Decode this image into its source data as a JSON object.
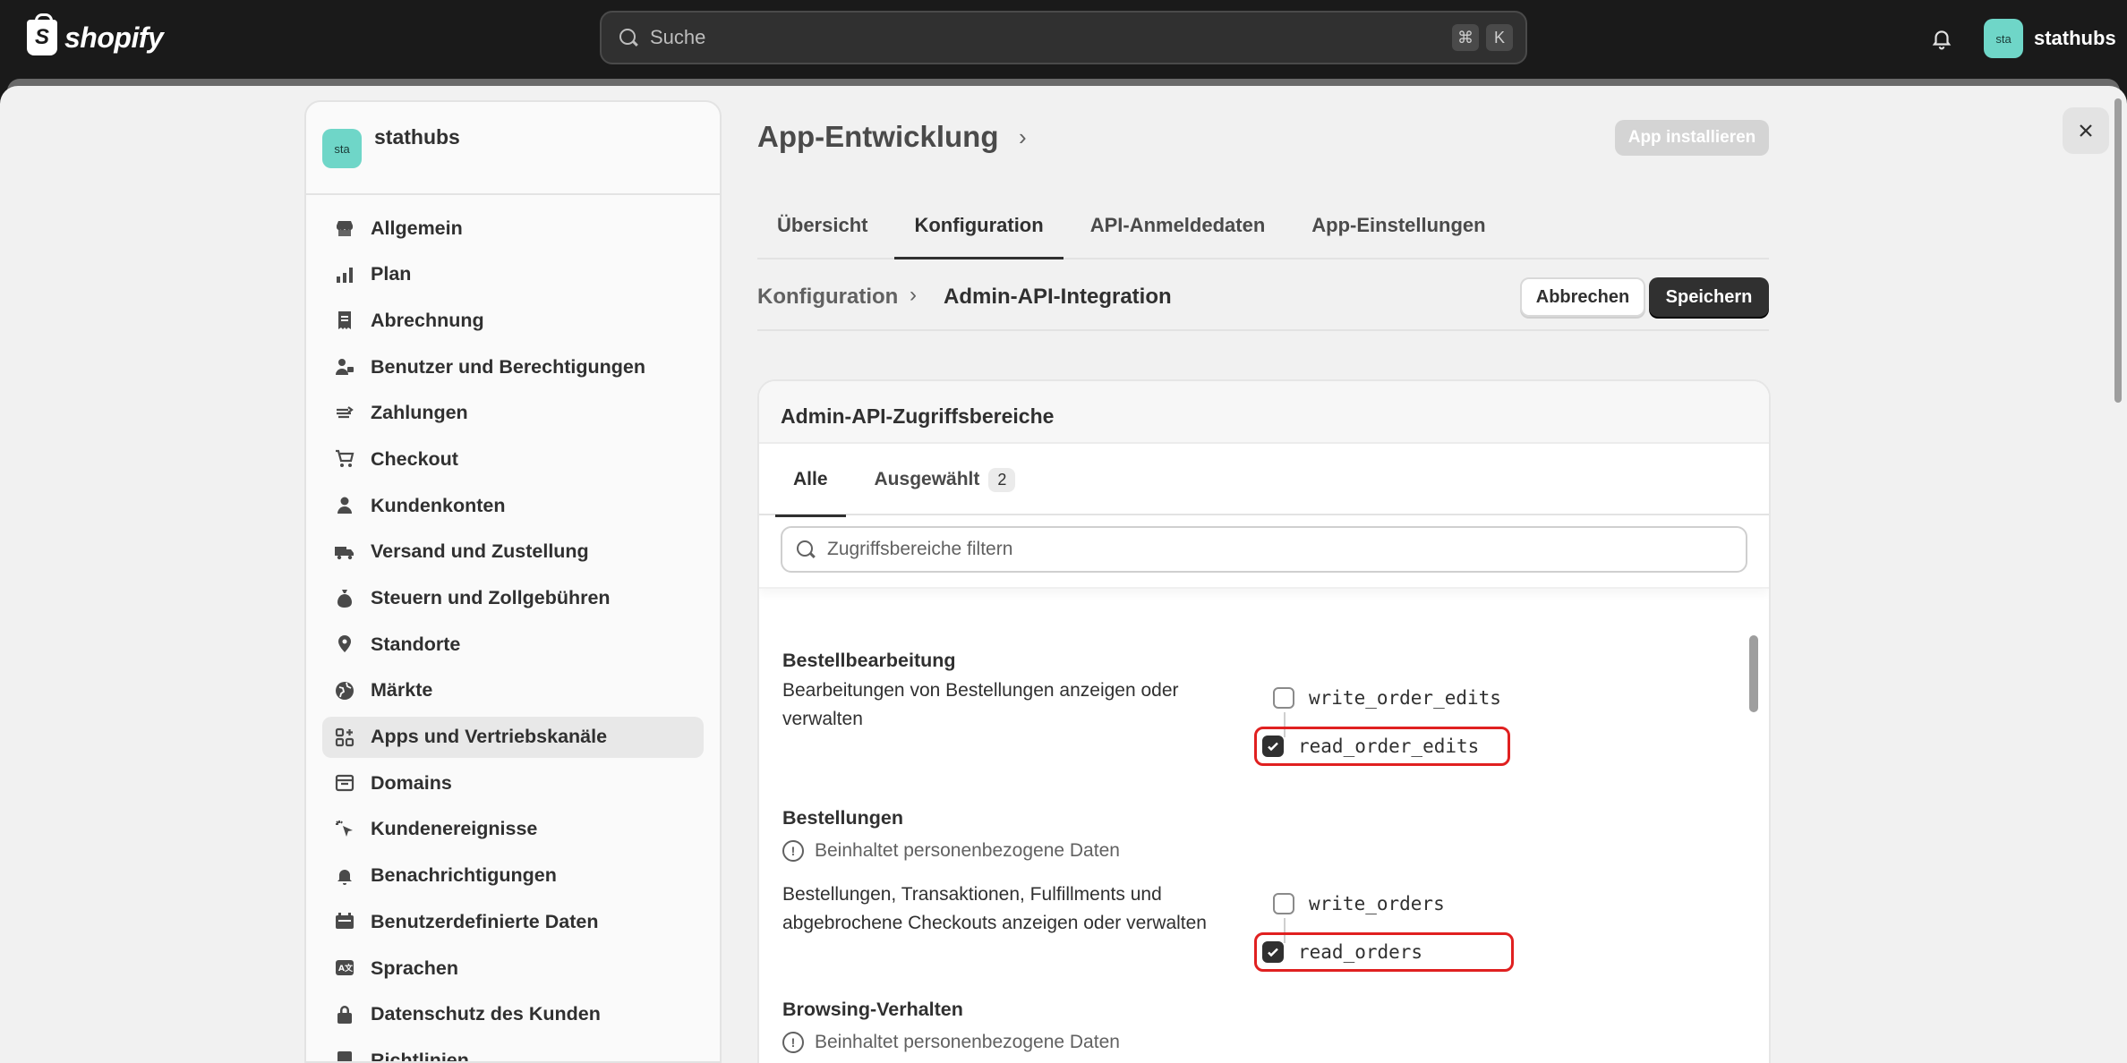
{
  "topbar": {
    "logo_text": "shopify",
    "logo_glyph": "S",
    "search_placeholder": "Suche",
    "shortcut_keys": [
      "⌘",
      "K"
    ],
    "account_avatar": "sta",
    "account_name": "stathubs",
    "bell_icon": "bell-icon"
  },
  "sidebar": {
    "store_avatar": "sta",
    "store_name": "stathubs",
    "items": [
      {
        "label": "Allgemein",
        "icon": "store-icon"
      },
      {
        "label": "Plan",
        "icon": "plan-icon"
      },
      {
        "label": "Abrechnung",
        "icon": "receipt-icon"
      },
      {
        "label": "Benutzer und Berechtigungen",
        "icon": "users-icon"
      },
      {
        "label": "Zahlungen",
        "icon": "payments-icon"
      },
      {
        "label": "Checkout",
        "icon": "cart-icon"
      },
      {
        "label": "Kundenkonten",
        "icon": "person-icon"
      },
      {
        "label": "Versand und Zustellung",
        "icon": "truck-icon"
      },
      {
        "label": "Steuern und Zollgebühren",
        "icon": "tax-icon"
      },
      {
        "label": "Standorte",
        "icon": "location-icon"
      },
      {
        "label": "Märkte",
        "icon": "globe-icon"
      },
      {
        "label": "Apps und Vertriebskanäle",
        "icon": "apps-icon",
        "active": true
      },
      {
        "label": "Domains",
        "icon": "domains-icon"
      },
      {
        "label": "Kundenereignisse",
        "icon": "cursor-icon"
      },
      {
        "label": "Benachrichtigungen",
        "icon": "bell-icon"
      },
      {
        "label": "Benutzerdefinierte Daten",
        "icon": "data-icon"
      },
      {
        "label": "Sprachen",
        "icon": "language-icon"
      },
      {
        "label": "Datenschutz des Kunden",
        "icon": "lock-icon"
      },
      {
        "label": "Richtlinien",
        "icon": "policy-icon"
      }
    ]
  },
  "page": {
    "title": "App-Entwicklung",
    "install_label": "App installieren",
    "tabs": [
      "Übersicht",
      "Konfiguration",
      "API-Anmeldedaten",
      "App-Einstellungen"
    ],
    "active_tab": "Konfiguration",
    "breadcrumb_parent": "Konfiguration",
    "breadcrumb_current": "Admin-API-Integration",
    "cancel_label": "Abbrechen",
    "save_label": "Speichern"
  },
  "card": {
    "title": "Admin-API-Zugriffsbereiche",
    "tabs": [
      {
        "label": "Alle",
        "active": true
      },
      {
        "label": "Ausgewählt",
        "count": "2"
      }
    ],
    "filter_placeholder": "Zugriffsbereiche filtern",
    "sections": [
      {
        "title": "Bestellbearbeitung",
        "description": "Bearbeitungen von Bestellungen anzeigen oder verwalten",
        "pii": "",
        "permissions": [
          {
            "scope": "write_order_edits",
            "checked": false
          },
          {
            "scope": "read_order_edits",
            "checked": true,
            "highlighted": true
          }
        ]
      },
      {
        "title": "Bestellungen",
        "pii": "Beinhaltet personenbezogene Daten",
        "description": "Bestellungen, Transaktionen, Fulfillments und abgebrochene Checkouts anzeigen oder verwalten",
        "permissions": [
          {
            "scope": "write_orders",
            "checked": false
          },
          {
            "scope": "read_orders",
            "checked": true,
            "highlighted": true
          }
        ]
      },
      {
        "title": "Browsing-Verhalten",
        "pii": "Beinhaltet personenbezogene Daten"
      }
    ]
  },
  "colors": {
    "topbar": "#1a1a1a",
    "accent": "#303030",
    "highlight": "#e02020",
    "store_avatar": "#6fd6c8"
  }
}
